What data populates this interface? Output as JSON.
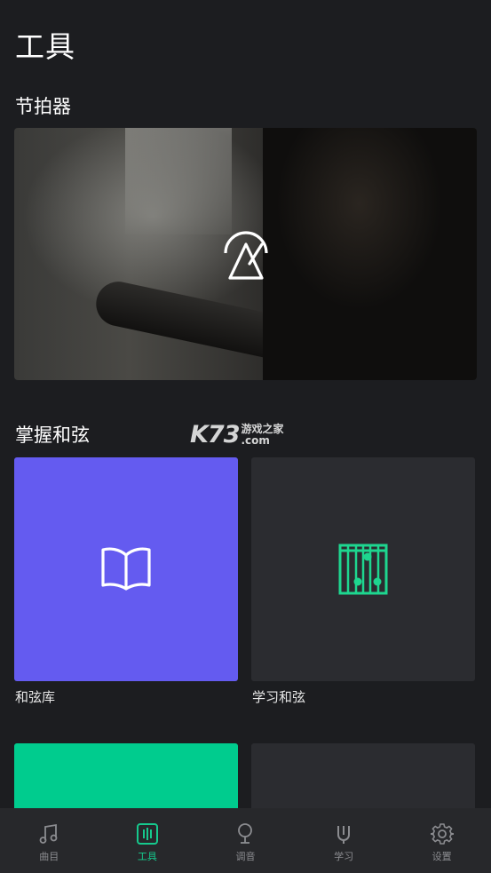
{
  "page": {
    "title": "工具"
  },
  "sections": {
    "metronome": {
      "title": "节拍器"
    },
    "chords": {
      "title": "掌握和弦"
    }
  },
  "watermark": {
    "big": "K73",
    "line1": "游戏之家",
    "line2": ".com"
  },
  "tiles": [
    {
      "label": "和弦库",
      "color": "#645bf0",
      "icon": "book-icon"
    },
    {
      "label": "学习和弦",
      "color": "#2b2c30",
      "icon": "chord-chart-icon",
      "icon_color": "#1ed68f"
    },
    {
      "label": "",
      "color": "#00cc8e"
    },
    {
      "label": "",
      "color": "#2b2c30"
    }
  ],
  "tabbar": {
    "items": [
      {
        "label": "曲目",
        "icon": "music-note-icon",
        "active": false
      },
      {
        "label": "工具",
        "icon": "tools-icon",
        "active": true
      },
      {
        "label": "调音",
        "icon": "tuner-icon",
        "active": false
      },
      {
        "label": "学习",
        "icon": "learn-icon",
        "active": false
      },
      {
        "label": "设置",
        "icon": "gear-icon",
        "active": false
      }
    ],
    "active_color": "#16c98d",
    "inactive_color": "#8b8c90"
  }
}
